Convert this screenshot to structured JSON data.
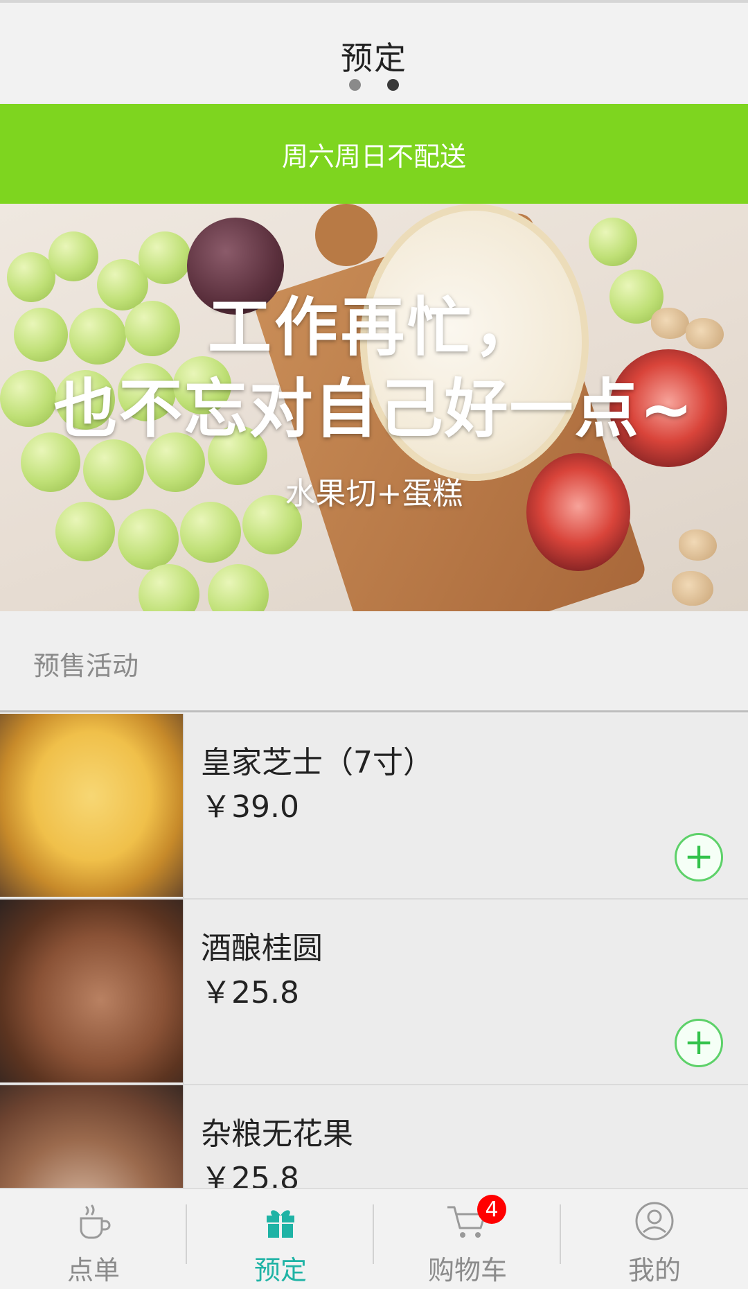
{
  "header": {
    "title": "预定",
    "page_dots": 2,
    "active_dot_index": 1
  },
  "notice": {
    "text": "周六周日不配送",
    "color": "#7ed51f"
  },
  "banner": {
    "line1": "工作再忙，",
    "line2": "也不忘对自己好一点~",
    "subtitle": "水果切+蛋糕"
  },
  "section": {
    "title": "预售活动"
  },
  "products": [
    {
      "name": "皇家芝士（7寸）",
      "price": "￥39.0",
      "add_label": "+"
    },
    {
      "name": "酒酿桂圆",
      "price": "￥25.8",
      "add_label": "+"
    },
    {
      "name": "杂粮无花果",
      "price": "￥25.8",
      "add_label": "+"
    }
  ],
  "tabbar": {
    "tabs": [
      {
        "label": "点单",
        "icon": "coffee-cup-icon",
        "active": false
      },
      {
        "label": "预定",
        "icon": "gift-icon",
        "active": true
      },
      {
        "label": "购物车",
        "icon": "cart-icon",
        "active": false,
        "badge": "4"
      },
      {
        "label": "我的",
        "icon": "user-icon",
        "active": false
      }
    ],
    "active_color": "#1fb3a5",
    "inactive_color": "#8b8b8b",
    "badge_color": "#ff0000"
  },
  "colors": {
    "accent_green": "#33c24b",
    "teal": "#1fb3a5"
  }
}
